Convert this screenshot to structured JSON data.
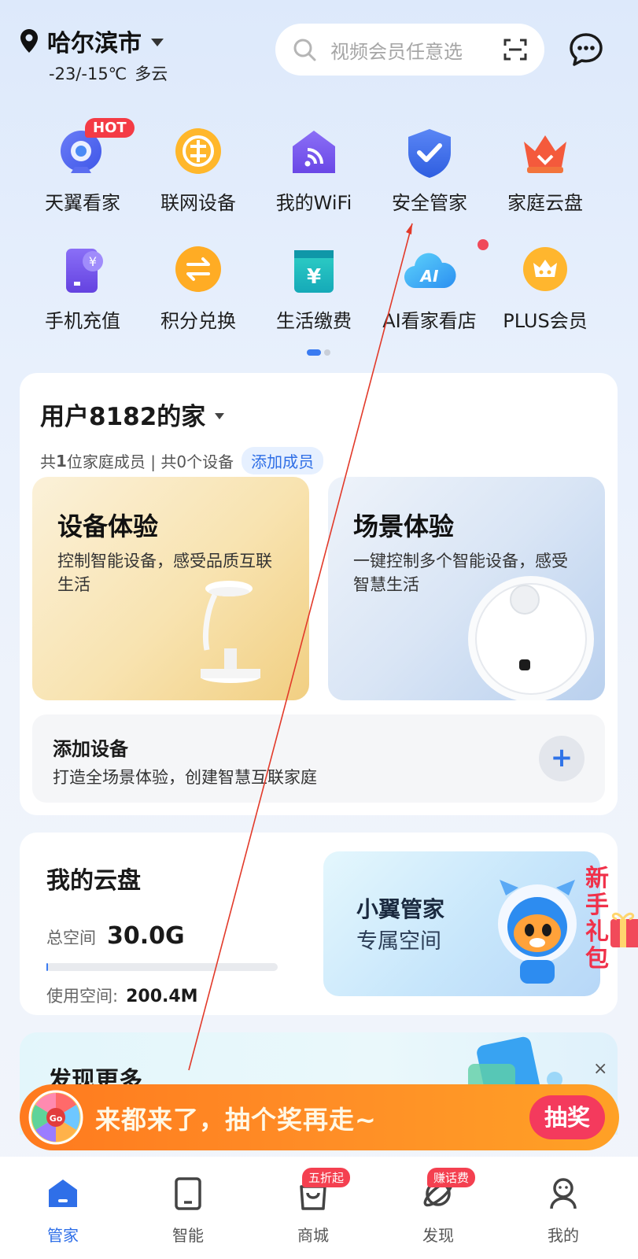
{
  "header": {
    "city": "哈尔滨市",
    "temperature": "-23/-15℃",
    "weather": "多云",
    "search_placeholder": "视频会员任意选"
  },
  "shortcuts": [
    {
      "label": "天翼看家",
      "icon": "camera-icon",
      "badge": "HOT"
    },
    {
      "label": "联网设备",
      "icon": "network-device-icon"
    },
    {
      "label": "我的WiFi",
      "icon": "wifi-home-icon"
    },
    {
      "label": "安全管家",
      "icon": "shield-check-icon"
    },
    {
      "label": "家庭云盘",
      "icon": "crown-cloud-icon"
    },
    {
      "label": "手机充值",
      "icon": "phone-recharge-icon"
    },
    {
      "label": "积分兑换",
      "icon": "points-exchange-icon"
    },
    {
      "label": "生活缴费",
      "icon": "bill-payment-icon"
    },
    {
      "label": "AI看家看店",
      "icon": "ai-cloud-icon"
    },
    {
      "label": "PLUS会员",
      "icon": "plus-member-icon"
    }
  ],
  "home": {
    "title": "用户8182的家",
    "members_prefix": "共",
    "members_count": "1",
    "members_suffix": "位家庭成员 | 共0个设备",
    "add_member": "添加成员",
    "device_exp": {
      "title": "设备体验",
      "desc": "控制智能设备，感受品质互联生活"
    },
    "scene_exp": {
      "title": "场景体验",
      "desc": "一键控制多个智能设备，感受智慧生活"
    },
    "add_device": {
      "title": "添加设备",
      "desc": "打造全场景体验，创建智慧互联家庭",
      "button": "+"
    }
  },
  "cloud": {
    "title": "我的云盘",
    "total_label": "总空间",
    "total_value": "30.0G",
    "used_label": "使用空间:",
    "used_value": "200.4M",
    "used_fraction": 0.007,
    "banner_title": "小翼管家",
    "banner_sub": "专属空间"
  },
  "floating": {
    "newbie_gift": "新手礼包"
  },
  "discover": {
    "title": "发现更多",
    "close": "×"
  },
  "lottery": {
    "text": "来都来了，抽个奖再走~",
    "button": "抽奖",
    "wheel_label": "Go"
  },
  "nav": [
    {
      "label": "管家",
      "icon": "home-icon",
      "active": true
    },
    {
      "label": "智能",
      "icon": "tablet-icon"
    },
    {
      "label": "商城",
      "icon": "shopping-bag-icon",
      "badge": "五折起"
    },
    {
      "label": "发现",
      "icon": "planet-icon",
      "badge": "赚话费"
    },
    {
      "label": "我的",
      "icon": "profile-icon"
    }
  ],
  "colors": {
    "accent": "#2f6fe8",
    "lottery": "#ff8d26",
    "badge_red": "#f44050"
  }
}
